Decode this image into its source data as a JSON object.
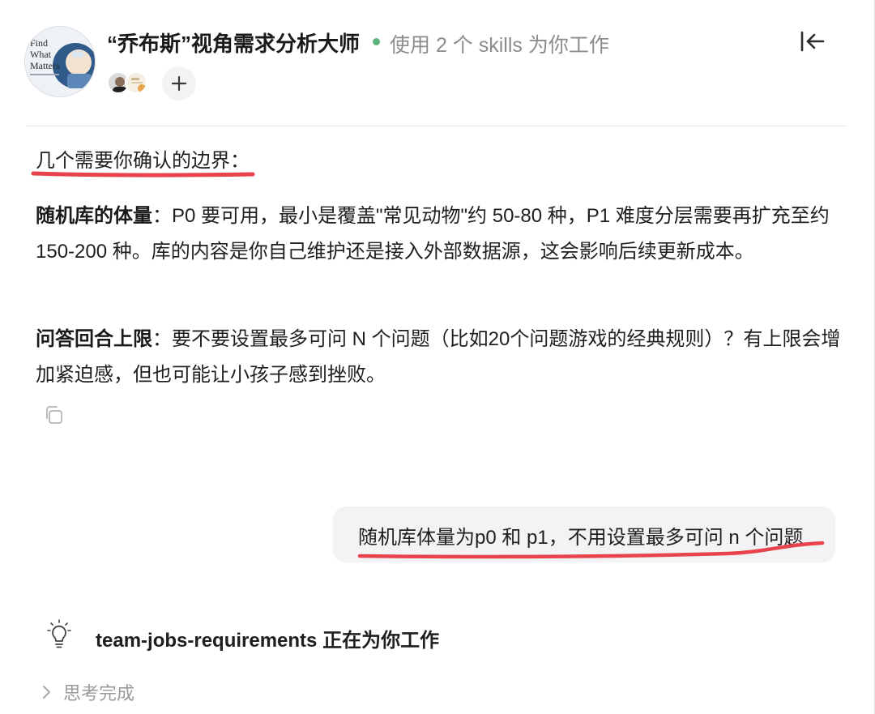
{
  "header": {
    "agent_name": "“乔布斯”视角需求分析大师",
    "status_text": "使用 2 个 skills 为你工作",
    "status_color": "#5fb27a",
    "avatar_book_text": [
      "Find",
      "What",
      "Matters"
    ],
    "collapse_icon": "collapse-left-icon",
    "add_icon": "plus-icon"
  },
  "message": {
    "heading": "几个需要你确认的边界：",
    "items": [
      {
        "label": "随机库的体量",
        "text": "：P0 要可用，最小是覆盖\"常见动物\"约 50-80 种，P1 难度分层需要再扩充至约 150-200 种。库的内容是你自己维护还是接入外部数据源，这会影响后续更新成本。"
      },
      {
        "label": "问答回合上限",
        "text": "：要不要设置最多可问 N 个问题（比如20个问题游戏的经典规则）？有上限会增加紧迫感，但也可能让小孩子感到挫败。"
      }
    ],
    "copy_icon": "copy-icon"
  },
  "user_message": {
    "text": "随机库体量为p0 和 p1，不用设置最多可问 n 个问题"
  },
  "working": {
    "text": "team-jobs-requirements 正在为你工作",
    "icon": "lightbulb-icon"
  },
  "thinking": {
    "label": "思考完成",
    "icon": "chevron-right-icon"
  },
  "annotation_color": "#e8434b"
}
